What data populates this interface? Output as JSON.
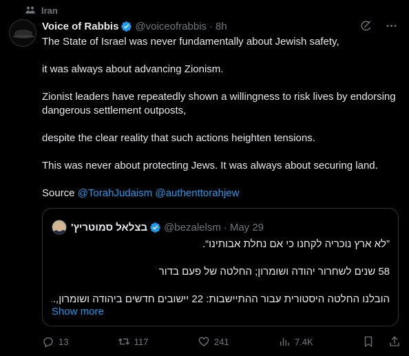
{
  "community": {
    "label": "Iran",
    "icon": "community-icon"
  },
  "author": {
    "name": "Voice of Rabbis",
    "handle": "@voiceofrabbis",
    "separator": "·",
    "time": "8h",
    "verified_color": "#1d9bf0"
  },
  "body": {
    "p1": "The State of Israel was never fundamentally about Jewish safety,",
    "p2": "it was always about advancing Zionism.",
    "p3": "Zionist leaders have repeatedly shown a willingness to risk lives by endorsing dangerous settlement outposts,",
    "p4": "despite the clear reality that such actions heighten tensions.",
    "p5": "This was never about protecting Jews. It was always about securing land.",
    "source_label": "Source",
    "mention1": "@TorahJudaism",
    "mention2": "@authenttorahjew"
  },
  "quote": {
    "name": "בצלאל סמוטריץ'",
    "handle": "@bezalelsm",
    "separator": "·",
    "time": "May 29",
    "line1": "”לא ארץ נוכריה לקחנו כי אם נחלת אבותינו“.",
    "line2": "58 שנים לשחרור יהודה ושומרון; החלטה של פעם בדור",
    "line3": "הובלנו החלטה היסטורית עבור ההתיישבות: 22 יישובים חדשים ביהודה ושומרון,...",
    "show_more": "Show more"
  },
  "actions": {
    "replies": "13",
    "reposts": "117",
    "likes": "241",
    "views": "7.4K"
  },
  "colors": {
    "accent": "#1d9bf0",
    "muted": "#71767b",
    "text": "#e7e9ea",
    "background": "#000000",
    "border": "#2f3336"
  }
}
